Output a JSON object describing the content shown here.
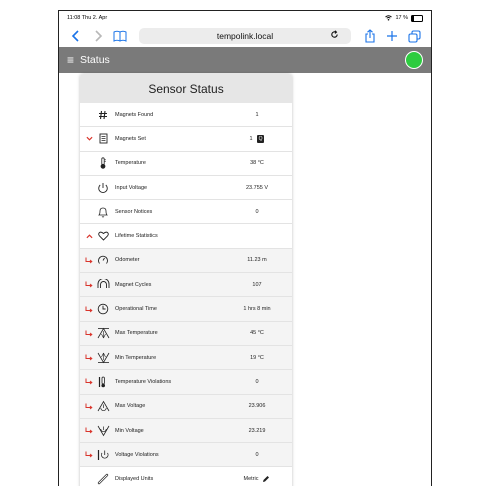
{
  "statusbar": {
    "time": "11:08",
    "date": "Thu 2. Apr",
    "battery": "17 %"
  },
  "browser": {
    "url": "tempolink.local"
  },
  "appbar": {
    "title": "Status"
  },
  "card": {
    "title": "Sensor Status",
    "rows": [
      {
        "label": "Magnets Found",
        "value": "1"
      },
      {
        "label": "Magnets Set",
        "value": "1",
        "badge": "Q"
      },
      {
        "label": "Temperature",
        "value": "38 °C"
      },
      {
        "label": "Input Voltage",
        "value": "23.755 V"
      },
      {
        "label": "Sensor Notices",
        "value": "0"
      },
      {
        "label": "Lifetime Statistics",
        "value": ""
      },
      {
        "label": "Odometer",
        "value": "11.23 m"
      },
      {
        "label": "Magnet Cycles",
        "value": "107"
      },
      {
        "label": "Operational Time",
        "value": "1 hrs 8 min"
      },
      {
        "label": "Max Temperature",
        "value": "45 °C"
      },
      {
        "label": "Min Temperature",
        "value": "19 °C"
      },
      {
        "label": "Temperature Violations",
        "value": "0"
      },
      {
        "label": "Max Voltage",
        "value": "23.906"
      },
      {
        "label": "Min Voltage",
        "value": "23.219"
      },
      {
        "label": "Voltage Violations",
        "value": "0"
      },
      {
        "label": "Displayed Units",
        "value": "Metric"
      }
    ]
  },
  "colors": {
    "accent": "#1a73e8",
    "expander": "#d9342b",
    "status_ok": "#2ecc40",
    "appbar": "#7a7a7a"
  }
}
